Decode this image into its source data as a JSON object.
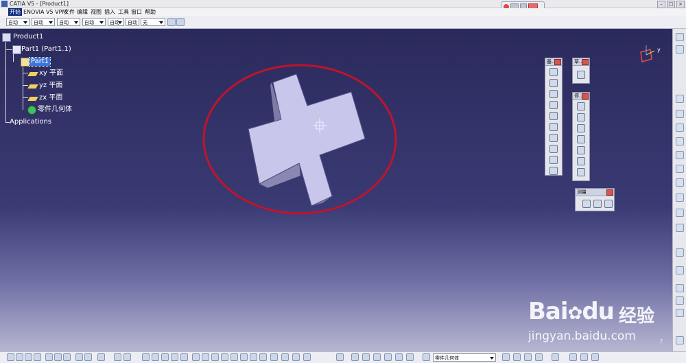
{
  "window": {
    "title": "CATIA V5 - [Product1]"
  },
  "menu": {
    "items": [
      "开始",
      "ENOVIA V5 VPM",
      "文件",
      "编辑",
      "视图",
      "插入",
      "工具",
      "窗口",
      "帮助"
    ]
  },
  "toolbar_top": {
    "combos": [
      "自动",
      "自动",
      "自动",
      "自动",
      "自动",
      "自动",
      "无"
    ]
  },
  "tree": {
    "root": "Product1",
    "part_instance": "Part1 (Part1.1)",
    "part": "Part1",
    "planes": [
      "xy 平面",
      "yz 平面",
      "zx 平面"
    ],
    "body": "零件几何体",
    "applications": "Applications"
  },
  "panels": {
    "sketch_based": "基...",
    "sketch": "草...",
    "transform": "停...",
    "measure": "测量"
  },
  "bottom_toolbar": {
    "body_combo": "零件几何体"
  },
  "compass": {
    "axis_y": "y",
    "axis_z": "z"
  },
  "watermark": {
    "brand": "Bai",
    "brand_du": "du",
    "brand_cn": "经验",
    "url": "jingyan.baidu.com"
  },
  "colors": {
    "background_top": "#2b2a5c",
    "background_bottom": "#b6b6d2",
    "selection": "#3d76d6",
    "highlight_ellipse": "#c0142a",
    "part_top_face": "#c8c6ea",
    "part_side_face": "#8a88b2"
  }
}
